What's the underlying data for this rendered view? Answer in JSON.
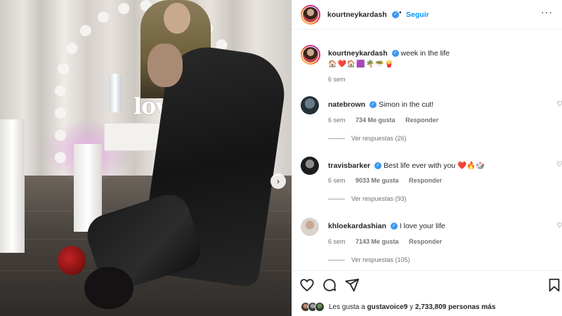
{
  "post": {
    "username": "kourtneykardash",
    "follow_label": "Seguir",
    "more_label": "···",
    "next_label": "›"
  },
  "caption": {
    "username": "kourtneykardash",
    "text": "week in the life",
    "emojis": "🏠❤️🏠🟪🌴🥗🍟",
    "time": "6 sem"
  },
  "comments": [
    {
      "username": "natebrown",
      "text": "Simon in the cut!",
      "time": "6 sem",
      "likes": "734 Me gusta",
      "reply_label": "Responder",
      "replies_label": "Ver respuestas (26)"
    },
    {
      "username": "travisbarker",
      "text": "Best life ever with you ❤️🔥🎲",
      "time": "6 sem",
      "likes": "9033 Me gusta",
      "reply_label": "Responder",
      "replies_label": "Ver respuestas (93)"
    },
    {
      "username": "khloekardashian",
      "text": "I love your life",
      "time": "6 sem",
      "likes": "7143 Me gusta",
      "reply_label": "Responder",
      "replies_label": "Ver respuestas (105)"
    }
  ],
  "likes_bar": {
    "prefix": "Les gusta a",
    "user": "gustavoice9",
    "connector": "y",
    "count": "2,733,809 personas más"
  },
  "photo": {
    "sign_text": "love"
  },
  "colors": {
    "accent": "#0095f6",
    "verified": "#3897f0",
    "heart_red": "#ed4956"
  },
  "icons": [
    "heart-icon",
    "comment-icon",
    "share-icon",
    "bookmark-icon",
    "more-icon",
    "chevron-right-icon",
    "verified-icon"
  ]
}
